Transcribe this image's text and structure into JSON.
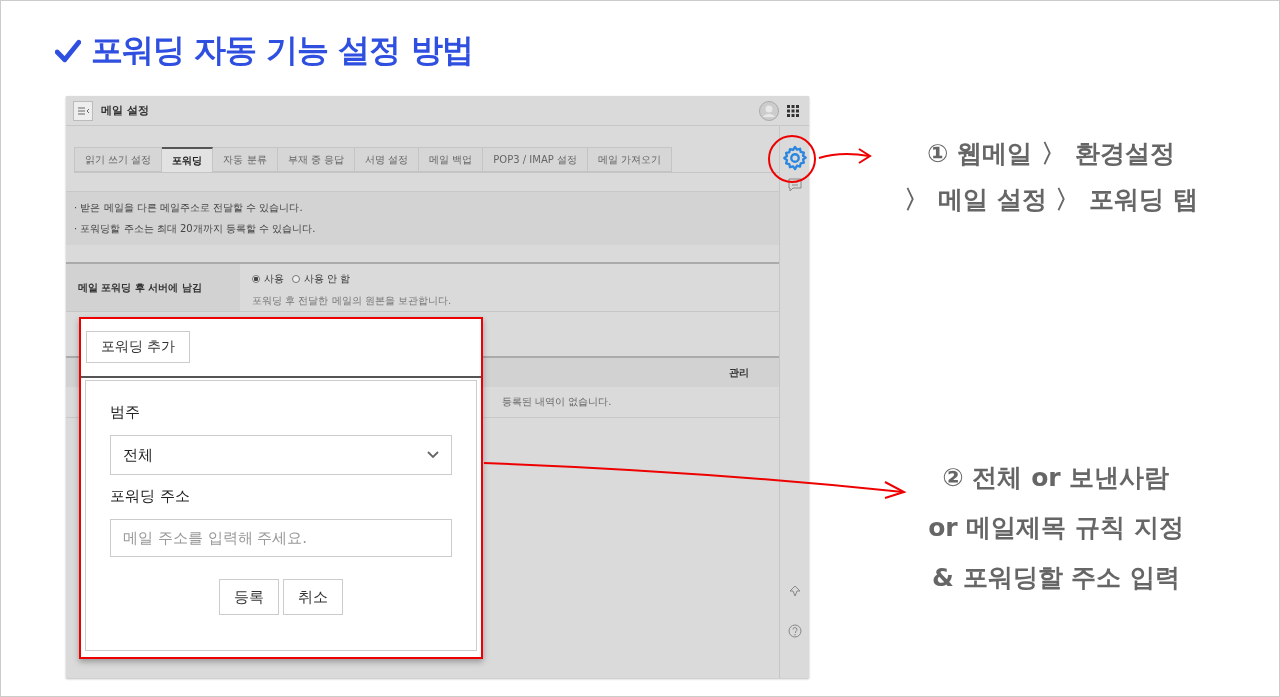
{
  "heading": "포워딩 자동 기능 설정 방법",
  "screen": {
    "title": "메일 설정",
    "tabs": [
      {
        "label": "읽기 쓰기 설정",
        "selected": false
      },
      {
        "label": "포워딩",
        "selected": true
      },
      {
        "label": "자동 분류",
        "selected": false
      },
      {
        "label": "부재 중 응답",
        "selected": false
      },
      {
        "label": "서명 설정",
        "selected": false
      },
      {
        "label": "메일 백업",
        "selected": false
      },
      {
        "label": "POP3 / IMAP 설정",
        "selected": false
      },
      {
        "label": "메일 가져오기",
        "selected": false
      }
    ],
    "notices": [
      "· 받은 메일을 다른 메일주소로 전달할 수 있습니다.",
      "· 포워딩할 주소는 최대 20개까지 등록할 수 있습니다."
    ],
    "setting": {
      "label": "메일 포워딩 후 서버에 남김",
      "options": [
        {
          "label": "사용",
          "selected": true
        },
        {
          "label": "사용 안 함",
          "selected": false
        }
      ],
      "hint": "포워딩 후 전달한 메일의 원본을 보관합니다."
    },
    "table": {
      "column": "관리",
      "empty": "등록된 내역이 없습니다."
    },
    "popup": {
      "add_button": "포워딩 추가",
      "category_label": "범주",
      "category_value": "전체",
      "address_label": "포워딩 주소",
      "address_placeholder": "메일 주소를 입력해 주세요.",
      "buttons": [
        "등록",
        "취소"
      ]
    }
  },
  "callouts": [
    "① 웹메일 〉 환경설정\n〉 메일 설정 〉 포워딩 탭",
    "② 전체 or 보낸사람\nor 메일제목 규칙 지정\n& 포워딩할 주소 입력"
  ]
}
